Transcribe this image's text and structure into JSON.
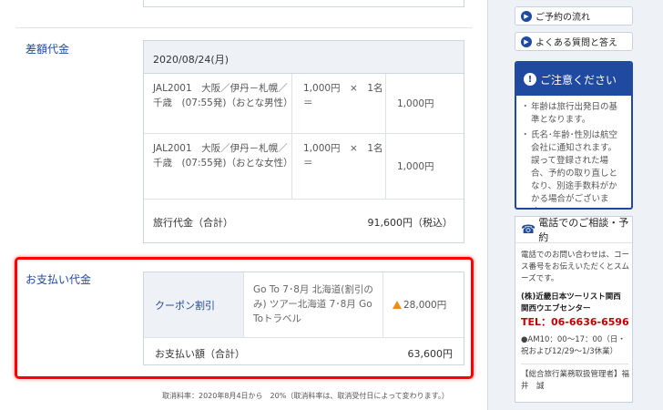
{
  "diff_section": {
    "label": "差額代金",
    "date_header": "2020/08/24(月)",
    "rows": [
      {
        "desc": "JAL2001　大阪／伊丹－札幌／千歳　(07:55発)（おとな男性）",
        "qty": "1,000円　×　1名　＝",
        "subtotal": "1,000円"
      },
      {
        "desc": "JAL2001　大阪／伊丹－札幌／千歳　(07:55発)（おとな女性）",
        "qty": "1,000円　×　1名　＝",
        "subtotal": "1,000円"
      }
    ],
    "total_label": "旅行代金（合計）",
    "total_value": "91,600円（税込）"
  },
  "payment_section": {
    "label": "お支払い代金",
    "coupon_label": "クーポン割引",
    "coupon_desc": "Go To 7･8月 北海道(割引のみ) ツアー北海道 7･8月 Go Toトラベル",
    "coupon_amount": "28,000円",
    "pay_total_label": "お支払い額（合計）",
    "pay_total_value": "63,600円"
  },
  "footnote": "取消料率：2020年8月4日から　20%（取消料率は、取消受付日によって変わります。）",
  "sidebar": {
    "flow_link": "ご予約の流れ",
    "faq_link": "よくある質問と答え",
    "notice_title": "ご注意ください",
    "notice_items": [
      "年齢は旅行出発日の基準となります。",
      "氏名･年齢･性別は航空会社に通知されます。誤って登録された場合、予約の取り直しとなり、別途手数料がかかる場合がございます。"
    ],
    "contact_title": "電話でのご相談・予約",
    "contact_intro": "電話でのお問い合わせは、コース番号をお伝えいただくとスムーズです。",
    "company": "(株)近畿日本ツーリスト関西　関西ウエブセンター",
    "tel": "TEL：06-6636-6596",
    "hours": "●AM10：00～17：00（日・祝および12/29～1/3休業）",
    "manager": "【総合旅行業務取扱管理者】福井　誠"
  },
  "colors": {
    "accent_blue": "#1f4aa0",
    "highlight_red": "#ff0000",
    "discount_orange": "#f08c1a"
  }
}
